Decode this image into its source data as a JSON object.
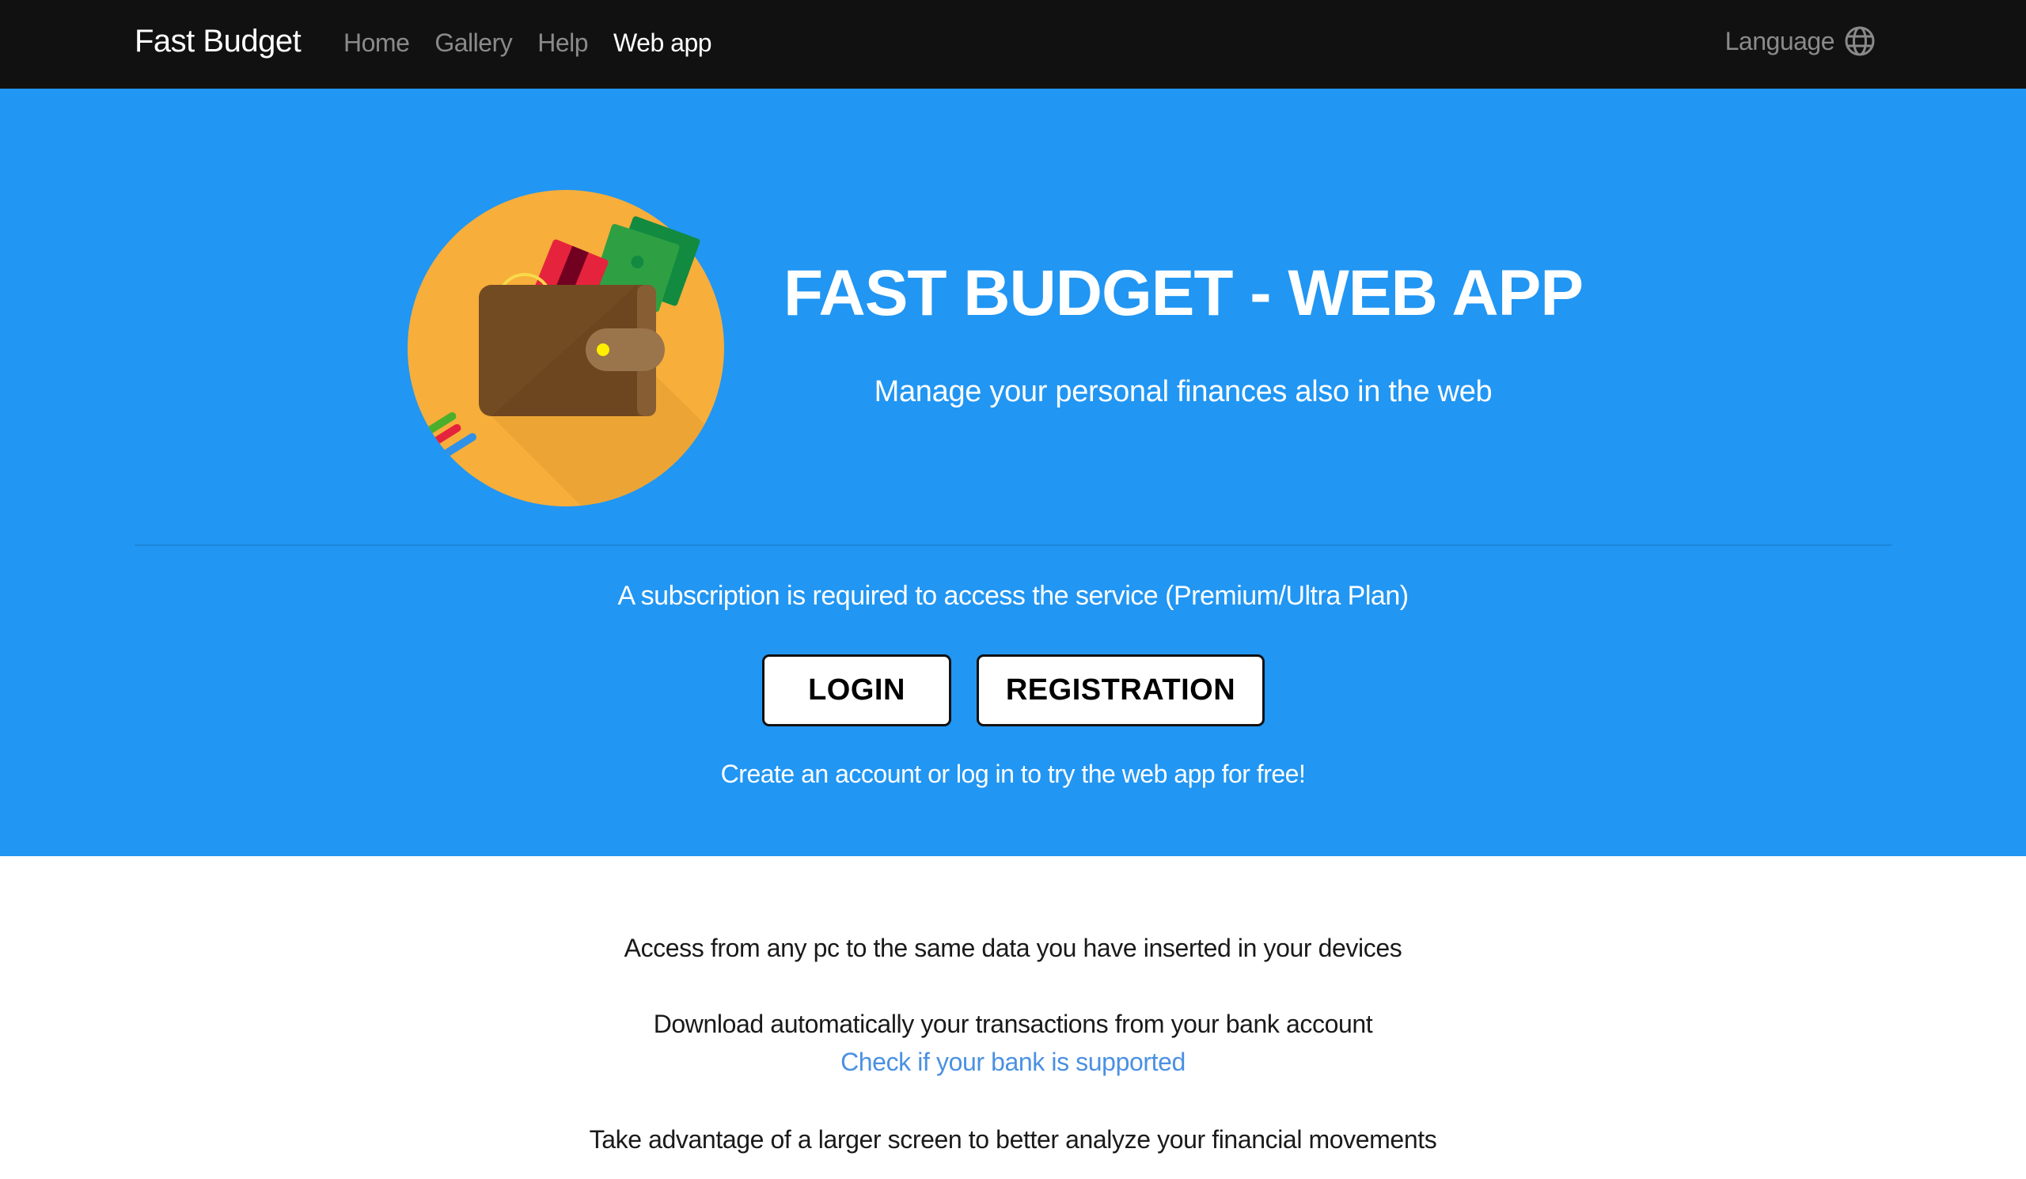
{
  "navbar": {
    "brand": "Fast Budget",
    "links": [
      {
        "label": "Home",
        "active": false
      },
      {
        "label": "Gallery",
        "active": false
      },
      {
        "label": "Help",
        "active": false
      },
      {
        "label": "Web app",
        "active": true
      }
    ],
    "language_label": "Language",
    "language_icon": "globe-icon"
  },
  "hero": {
    "logo_icon": "wallet-icon",
    "title": "FAST BUDGET - WEB APP",
    "subtitle": "Manage your personal finances also in the web",
    "subscription_note": "A subscription is required to access the service (Premium/Ultra Plan)",
    "login_label": "LOGIN",
    "registration_label": "REGISTRATION",
    "free_note": "Create an account or log in to try the web app for free!"
  },
  "features": {
    "items": [
      "Access from any pc to the same data you have inserted in your devices",
      "Download automatically your transactions from your bank account",
      "Take advantage of a larger screen to better analyze your financial movements"
    ],
    "bank_link": "Check if your bank is supported"
  },
  "colors": {
    "navbar_bg": "#111111",
    "hero_bg": "#2196f3",
    "link": "#4a90e2",
    "logo_bg": "#f7ae3b",
    "wallet": "#734b22"
  }
}
